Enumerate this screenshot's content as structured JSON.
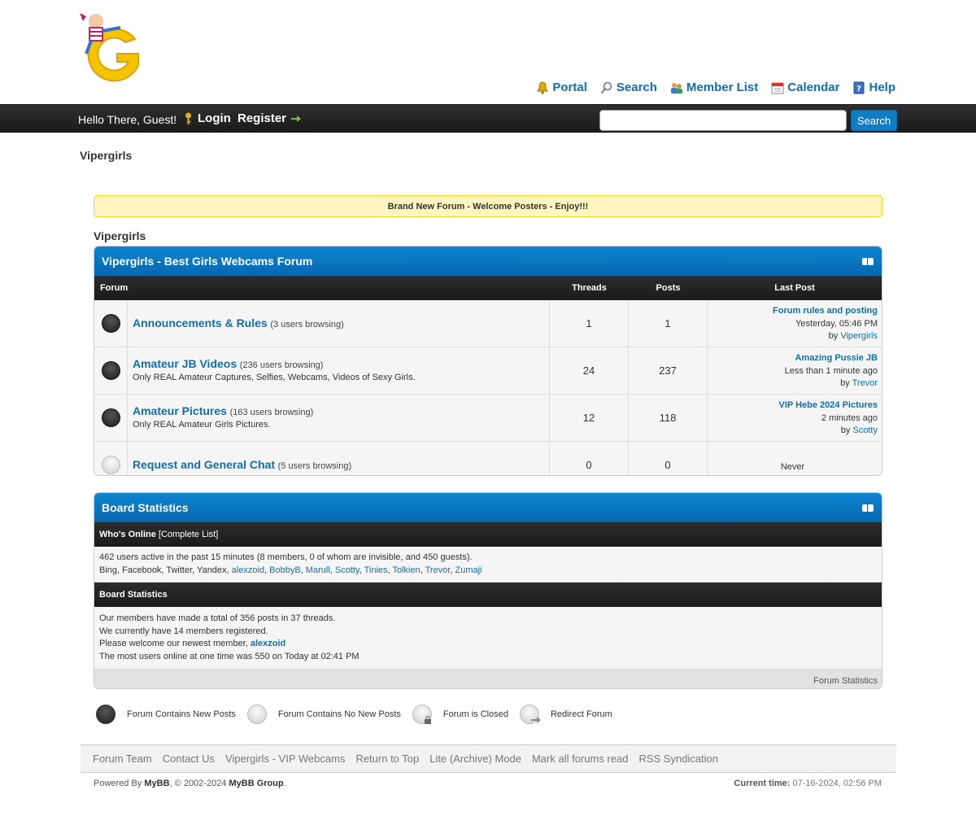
{
  "header": {
    "toplinks": [
      {
        "label": "Portal",
        "icon": "bell-icon"
      },
      {
        "label": "Search",
        "icon": "magnifier-icon"
      },
      {
        "label": "Member List",
        "icon": "members-icon"
      },
      {
        "label": "Calendar",
        "icon": "calendar-icon"
      },
      {
        "label": "Help",
        "icon": "help-icon"
      }
    ]
  },
  "panel": {
    "welcome": "Hello There, Guest!",
    "login": "Login",
    "register": "Register",
    "search_value": "",
    "search_button": "Search"
  },
  "breadcrumb": "Vipergirls",
  "announcement": "Brand New Forum - Welcome Posters - Enjoy!!!",
  "category_label": "Vipergirls",
  "forum_table": {
    "title": "Vipergirls - Best Girls Webcams Forum",
    "columns": {
      "forum": "Forum",
      "threads": "Threads",
      "posts": "Posts",
      "last_post": "Last Post"
    },
    "forums": [
      {
        "name": "Announcements & Rules",
        "browsing": "(3 users browsing)",
        "description": "",
        "threads": "1",
        "posts": "1",
        "last_title": "Forum rules and posting",
        "last_time": "Yesterday, 05:46 PM",
        "last_by": "by",
        "last_user": "Vipergirls",
        "status": "new"
      },
      {
        "name": "Amateur JB Videos",
        "browsing": "(236 users browsing)",
        "description": "Only REAL Amateur Captures, Selfies, Webcams, Videos of Sexy Girls.",
        "threads": "24",
        "posts": "237",
        "last_title": "Amazing Pussie JB",
        "last_time": "Less than 1 minute ago",
        "last_by": "by",
        "last_user": "Trevor",
        "status": "new"
      },
      {
        "name": "Amateur Pictures",
        "browsing": "(163 users browsing)",
        "description": "Only REAL Amateur Girls Pictures.",
        "threads": "12",
        "posts": "118",
        "last_title": "VIP Hebe 2024 Pictures",
        "last_time": "2 minutes ago",
        "last_by": "by",
        "last_user": "Scotty",
        "status": "new"
      },
      {
        "name": "Request and General Chat",
        "browsing": "(5 users browsing)",
        "description": "",
        "threads": "0",
        "posts": "0",
        "last_never": "Never",
        "status": "nonew"
      }
    ]
  },
  "stats": {
    "title": "Board Statistics",
    "whos_online_label": "Who's Online",
    "complete_list": "[Complete List]",
    "online_line": "462 users active in the past 15 minutes (8 members, 0 of whom are invisible, and 450 guests).",
    "bots": "Bing, Facebook, Twitter, Yandex,",
    "online_members": [
      "alexzoid",
      "BobbyB",
      "Marull",
      "Scotty",
      "Tinies",
      "Tolkien",
      "Trevor",
      "Zumaji"
    ],
    "board_stats_label": "Board Statistics",
    "line1": "Our members have made a total of 356 posts in 37 threads.",
    "line2": "We currently have 14 members registered.",
    "line3_prefix": "Please welcome our newest member,",
    "newest_member": "alexzoid",
    "line4": "The most users online at one time was 550 on Today at 02:41 PM",
    "footer_link": "Forum Statistics"
  },
  "legend": [
    {
      "label": "Forum Contains New Posts",
      "icon": "forum-new-icon"
    },
    {
      "label": "Forum Contains No New Posts",
      "icon": "forum-nonew-icon"
    },
    {
      "label": "Forum is Closed",
      "icon": "forum-closed-icon"
    },
    {
      "label": "Redirect Forum",
      "icon": "forum-redirect-icon"
    }
  ],
  "footer": {
    "links": [
      "Forum Team",
      "Contact Us",
      "Vipergirls - VIP Webcams",
      "Return to Top",
      "Lite (Archive) Mode",
      "Mark all forums read",
      "RSS Syndication"
    ],
    "powered_prefix": "Powered By",
    "mybb": "MyBB",
    "copyright": ", © 2002-2024",
    "mybb_group": "MyBB Group",
    "period": ".",
    "current_time_label": "Current time:",
    "current_time": "07-16-2024, 02:56 PM"
  },
  "colors": {
    "accent": "#0f6fae",
    "thead": "#0567b0",
    "announcement_bg": "#fff6bf"
  }
}
